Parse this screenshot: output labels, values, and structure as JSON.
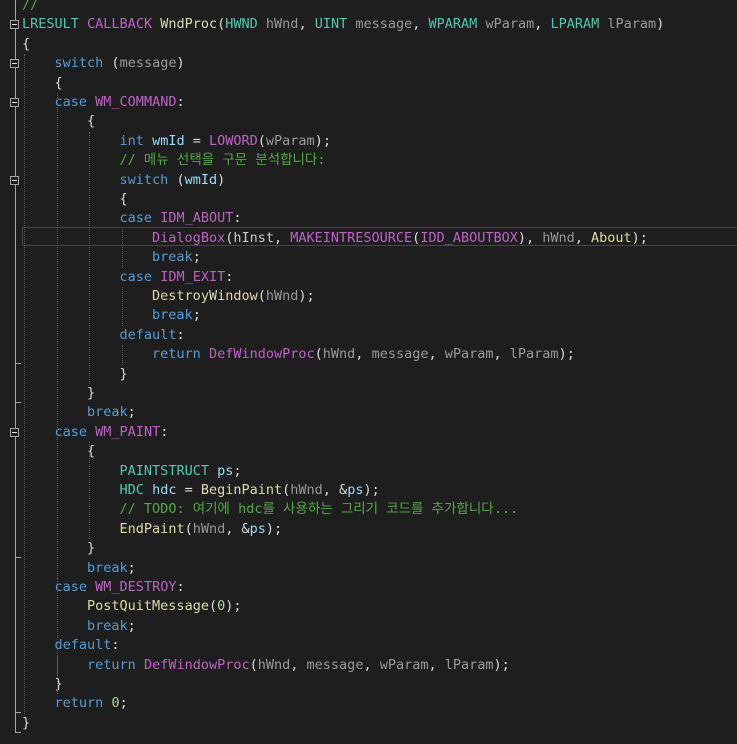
{
  "editor": {
    "lines": [
      [
        {
          "t": "//",
          "c": "cmt"
        }
      ],
      [
        {
          "t": "LRESULT",
          "c": "ty"
        },
        {
          "t": " ",
          "c": ""
        },
        {
          "t": "CALLBACK",
          "c": "mac"
        },
        {
          "t": " ",
          "c": ""
        },
        {
          "t": "WndProc",
          "c": "fn"
        },
        {
          "t": "(",
          "c": ""
        },
        {
          "t": "HWND",
          "c": "ty"
        },
        {
          "t": " ",
          "c": ""
        },
        {
          "t": "hWnd",
          "c": "par"
        },
        {
          "t": ", ",
          "c": ""
        },
        {
          "t": "UINT",
          "c": "ty"
        },
        {
          "t": " ",
          "c": ""
        },
        {
          "t": "message",
          "c": "par"
        },
        {
          "t": ", ",
          "c": ""
        },
        {
          "t": "WPARAM",
          "c": "ty"
        },
        {
          "t": " ",
          "c": ""
        },
        {
          "t": "wParam",
          "c": "par"
        },
        {
          "t": ", ",
          "c": ""
        },
        {
          "t": "LPARAM",
          "c": "ty"
        },
        {
          "t": " ",
          "c": ""
        },
        {
          "t": "lParam",
          "c": "par"
        },
        {
          "t": ")",
          "c": ""
        }
      ],
      [
        {
          "t": "{",
          "c": ""
        }
      ],
      [
        {
          "t": "    ",
          "c": ""
        },
        {
          "t": "switch",
          "c": "kw"
        },
        {
          "t": " (",
          "c": ""
        },
        {
          "t": "message",
          "c": "par"
        },
        {
          "t": ")",
          "c": ""
        }
      ],
      [
        {
          "t": "    {",
          "c": ""
        }
      ],
      [
        {
          "t": "    ",
          "c": ""
        },
        {
          "t": "case",
          "c": "kw"
        },
        {
          "t": " ",
          "c": ""
        },
        {
          "t": "WM_COMMAND",
          "c": "mac"
        },
        {
          "t": ":",
          "c": ""
        }
      ],
      [
        {
          "t": "        {",
          "c": ""
        }
      ],
      [
        {
          "t": "            ",
          "c": ""
        },
        {
          "t": "int",
          "c": "kw"
        },
        {
          "t": " ",
          "c": ""
        },
        {
          "t": "wmId",
          "c": "var"
        },
        {
          "t": " = ",
          "c": ""
        },
        {
          "t": "LOWORD",
          "c": "mac"
        },
        {
          "t": "(",
          "c": ""
        },
        {
          "t": "wParam",
          "c": "par"
        },
        {
          "t": ");",
          "c": ""
        }
      ],
      [
        {
          "t": "            ",
          "c": ""
        },
        {
          "t": "// 메뉴 선택을 구문 분석합니다:",
          "c": "cmt"
        }
      ],
      [
        {
          "t": "            ",
          "c": ""
        },
        {
          "t": "switch",
          "c": "kw"
        },
        {
          "t": " (",
          "c": ""
        },
        {
          "t": "wmId",
          "c": "var"
        },
        {
          "t": ")",
          "c": ""
        }
      ],
      [
        {
          "t": "            {",
          "c": ""
        }
      ],
      [
        {
          "t": "            ",
          "c": ""
        },
        {
          "t": "case",
          "c": "kw"
        },
        {
          "t": " ",
          "c": ""
        },
        {
          "t": "IDM_ABOUT",
          "c": "mac"
        },
        {
          "t": ":",
          "c": ""
        }
      ],
      [
        {
          "t": "                ",
          "c": ""
        },
        {
          "t": "DialogBox",
          "c": "mac"
        },
        {
          "t": "(",
          "c": ""
        },
        {
          "t": "hInst",
          "c": "ll"
        },
        {
          "t": ", ",
          "c": ""
        },
        {
          "t": "MAKEINTRESOURCE",
          "c": "mac"
        },
        {
          "t": "(",
          "c": ""
        },
        {
          "t": "IDD_ABOUTBOX",
          "c": "mac"
        },
        {
          "t": "), ",
          "c": ""
        },
        {
          "t": "hWnd",
          "c": "par"
        },
        {
          "t": ", ",
          "c": ""
        },
        {
          "t": "About",
          "c": "fn"
        },
        {
          "t": ");",
          "c": ""
        }
      ],
      [
        {
          "t": "                ",
          "c": ""
        },
        {
          "t": "break",
          "c": "kw"
        },
        {
          "t": ";",
          "c": ""
        }
      ],
      [
        {
          "t": "            ",
          "c": ""
        },
        {
          "t": "case",
          "c": "kw"
        },
        {
          "t": " ",
          "c": ""
        },
        {
          "t": "IDM_EXIT",
          "c": "mac"
        },
        {
          "t": ":",
          "c": ""
        }
      ],
      [
        {
          "t": "                ",
          "c": ""
        },
        {
          "t": "DestroyWindow",
          "c": "fn"
        },
        {
          "t": "(",
          "c": ""
        },
        {
          "t": "hWnd",
          "c": "par"
        },
        {
          "t": ");",
          "c": ""
        }
      ],
      [
        {
          "t": "                ",
          "c": ""
        },
        {
          "t": "break",
          "c": "kw"
        },
        {
          "t": ";",
          "c": ""
        }
      ],
      [
        {
          "t": "            ",
          "c": ""
        },
        {
          "t": "default",
          "c": "kw"
        },
        {
          "t": ":",
          "c": ""
        }
      ],
      [
        {
          "t": "                ",
          "c": ""
        },
        {
          "t": "return",
          "c": "kw"
        },
        {
          "t": " ",
          "c": ""
        },
        {
          "t": "DefWindowProc",
          "c": "mac"
        },
        {
          "t": "(",
          "c": ""
        },
        {
          "t": "hWnd",
          "c": "par"
        },
        {
          "t": ", ",
          "c": ""
        },
        {
          "t": "message",
          "c": "par"
        },
        {
          "t": ", ",
          "c": ""
        },
        {
          "t": "wParam",
          "c": "par"
        },
        {
          "t": ", ",
          "c": ""
        },
        {
          "t": "lParam",
          "c": "par"
        },
        {
          "t": ");",
          "c": ""
        }
      ],
      [
        {
          "t": "            }",
          "c": ""
        }
      ],
      [
        {
          "t": "        }",
          "c": ""
        }
      ],
      [
        {
          "t": "        ",
          "c": ""
        },
        {
          "t": "break",
          "c": "kw"
        },
        {
          "t": ";",
          "c": ""
        }
      ],
      [
        {
          "t": "    ",
          "c": ""
        },
        {
          "t": "case",
          "c": "kw"
        },
        {
          "t": " ",
          "c": ""
        },
        {
          "t": "WM_PAINT",
          "c": "mac"
        },
        {
          "t": ":",
          "c": ""
        }
      ],
      [
        {
          "t": "        {",
          "c": ""
        }
      ],
      [
        {
          "t": "            ",
          "c": ""
        },
        {
          "t": "PAINTSTRUCT",
          "c": "ty"
        },
        {
          "t": " ",
          "c": ""
        },
        {
          "t": "ps",
          "c": "var"
        },
        {
          "t": ";",
          "c": ""
        }
      ],
      [
        {
          "t": "            ",
          "c": ""
        },
        {
          "t": "HDC",
          "c": "ty"
        },
        {
          "t": " ",
          "c": ""
        },
        {
          "t": "hdc",
          "c": "var"
        },
        {
          "t": " = ",
          "c": ""
        },
        {
          "t": "BeginPaint",
          "c": "fn"
        },
        {
          "t": "(",
          "c": ""
        },
        {
          "t": "hWnd",
          "c": "par"
        },
        {
          "t": ", &",
          "c": ""
        },
        {
          "t": "ps",
          "c": "var"
        },
        {
          "t": ");",
          "c": ""
        }
      ],
      [
        {
          "t": "            ",
          "c": ""
        },
        {
          "t": "// TODO: 여기에 hdc를 사용하는 그리기 코드를 추가합니다...",
          "c": "cmt"
        }
      ],
      [
        {
          "t": "            ",
          "c": ""
        },
        {
          "t": "EndPaint",
          "c": "fn"
        },
        {
          "t": "(",
          "c": ""
        },
        {
          "t": "hWnd",
          "c": "par"
        },
        {
          "t": ", &",
          "c": ""
        },
        {
          "t": "ps",
          "c": "var"
        },
        {
          "t": ");",
          "c": ""
        }
      ],
      [
        {
          "t": "        }",
          "c": ""
        }
      ],
      [
        {
          "t": "        ",
          "c": ""
        },
        {
          "t": "break",
          "c": "kw"
        },
        {
          "t": ";",
          "c": ""
        }
      ],
      [
        {
          "t": "    ",
          "c": ""
        },
        {
          "t": "case",
          "c": "kw"
        },
        {
          "t": " ",
          "c": ""
        },
        {
          "t": "WM_DESTROY",
          "c": "mac"
        },
        {
          "t": ":",
          "c": ""
        }
      ],
      [
        {
          "t": "        ",
          "c": ""
        },
        {
          "t": "PostQuitMessage",
          "c": "fn"
        },
        {
          "t": "(",
          "c": ""
        },
        {
          "t": "0",
          "c": "num"
        },
        {
          "t": ");",
          "c": ""
        }
      ],
      [
        {
          "t": "        ",
          "c": ""
        },
        {
          "t": "break",
          "c": "kw"
        },
        {
          "t": ";",
          "c": ""
        }
      ],
      [
        {
          "t": "    ",
          "c": ""
        },
        {
          "t": "default",
          "c": "kw"
        },
        {
          "t": ":",
          "c": ""
        }
      ],
      [
        {
          "t": "        ",
          "c": ""
        },
        {
          "t": "return",
          "c": "kw"
        },
        {
          "t": " ",
          "c": ""
        },
        {
          "t": "DefWindowProc",
          "c": "mac"
        },
        {
          "t": "(",
          "c": ""
        },
        {
          "t": "hWnd",
          "c": "par"
        },
        {
          "t": ", ",
          "c": ""
        },
        {
          "t": "message",
          "c": "par"
        },
        {
          "t": ", ",
          "c": ""
        },
        {
          "t": "wParam",
          "c": "par"
        },
        {
          "t": ", ",
          "c": ""
        },
        {
          "t": "lParam",
          "c": "par"
        },
        {
          "t": ");",
          "c": ""
        }
      ],
      [
        {
          "t": "    }",
          "c": ""
        }
      ],
      [
        {
          "t": "    ",
          "c": ""
        },
        {
          "t": "return",
          "c": "kw"
        },
        {
          "t": " ",
          "c": ""
        },
        {
          "t": "0",
          "c": "num"
        },
        {
          "t": ";",
          "c": ""
        }
      ],
      [
        {
          "t": "}",
          "c": ""
        }
      ]
    ],
    "colors": {
      "background": "#1e1e1e",
      "keyword": "#569cd6",
      "function": "#dcdcaa",
      "type": "#4ec9b0",
      "macro": "#bd63c5",
      "comment": "#57a64a",
      "number": "#b5cea8",
      "local_variable": "#9cdcfe",
      "parameter": "#9a9a9a",
      "plain": "#dcdcdc"
    },
    "icons": {
      "fold_toggle": "collapse-minus-icon"
    }
  }
}
